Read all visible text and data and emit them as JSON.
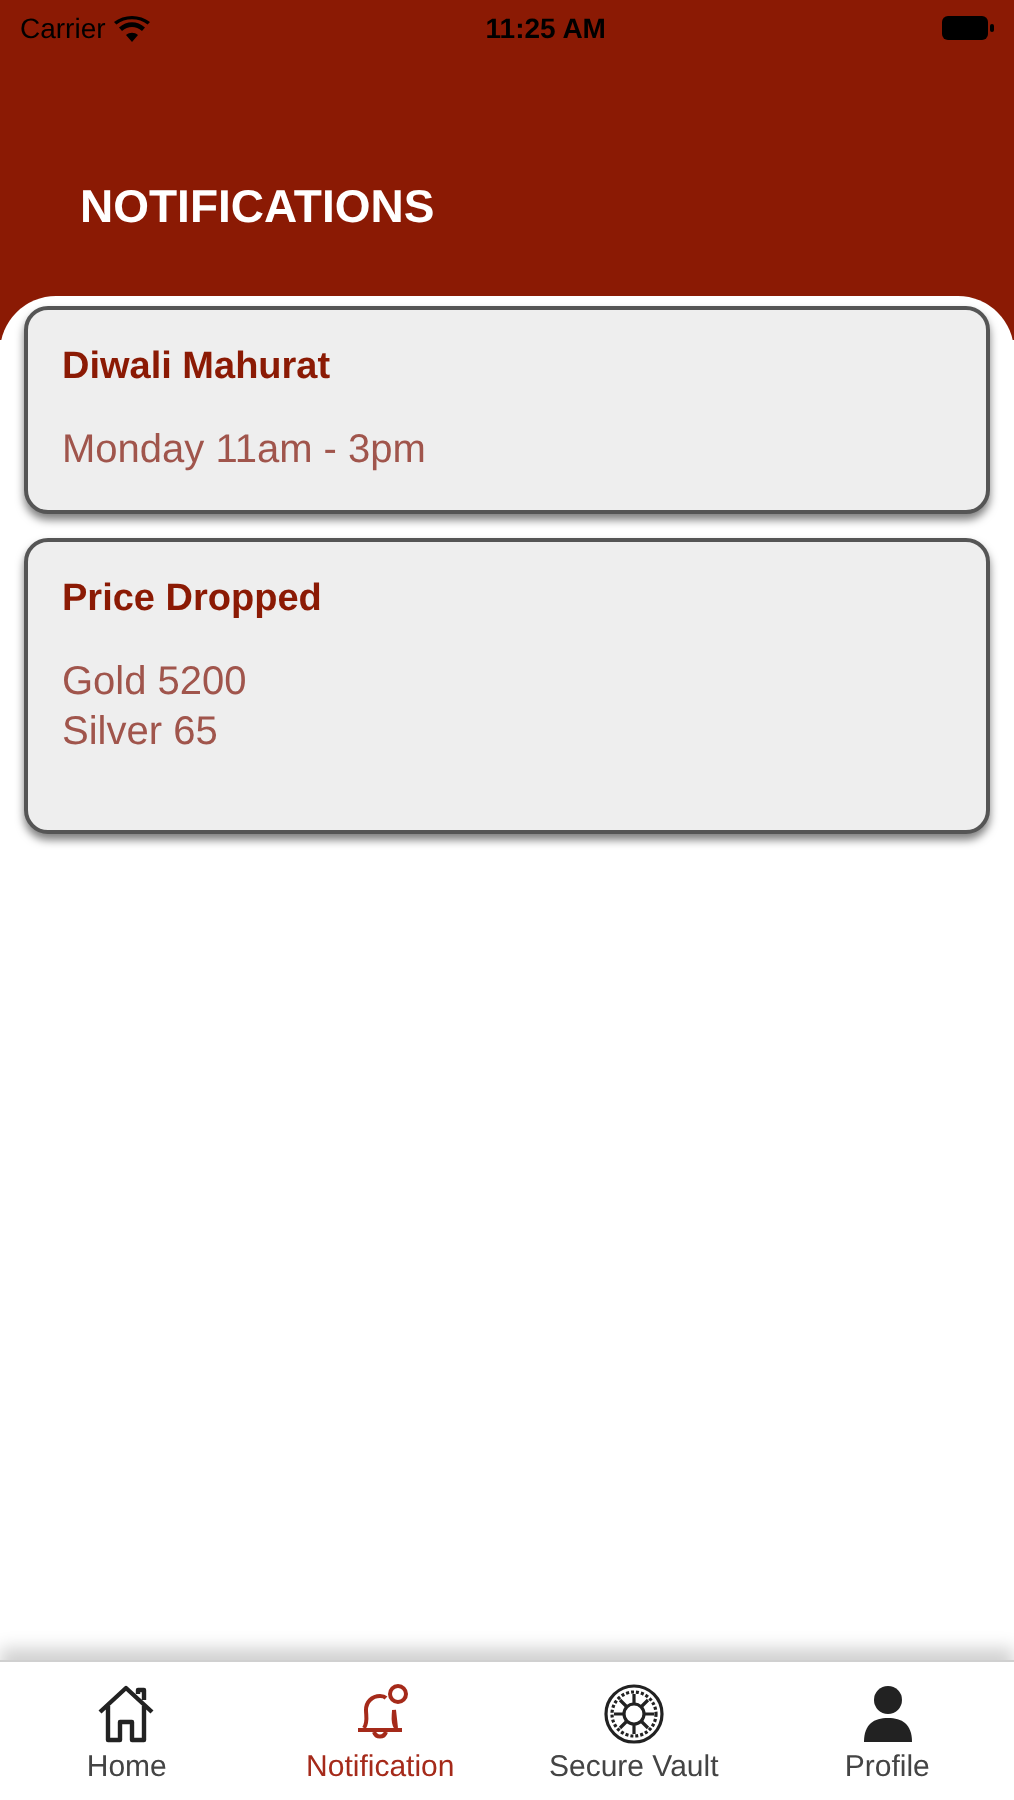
{
  "status_bar": {
    "carrier": "Carrier",
    "time": "11:25 AM"
  },
  "title": "NOTIFICATIONS",
  "notifications": [
    {
      "title": "Diwali Mahurat",
      "lines": [
        "Monday 11am - 3pm"
      ]
    },
    {
      "title": "Price Dropped",
      "lines": [
        "Gold 5200",
        "Silver 65"
      ]
    }
  ],
  "tabs": [
    {
      "kind": "home",
      "label": "Home",
      "selected": false
    },
    {
      "kind": "bell",
      "label": "Notification",
      "selected": true
    },
    {
      "kind": "vault",
      "label": "Secure Vault",
      "selected": false
    },
    {
      "kind": "profile",
      "label": "Profile",
      "selected": false
    }
  ]
}
